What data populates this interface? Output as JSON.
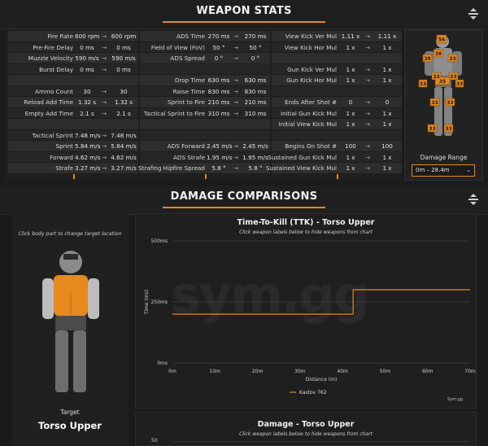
{
  "weapon_stats": {
    "title": "WEAPON STATS",
    "col1": [
      {
        "label": "Fire Rate",
        "v1": "600 rpm",
        "v2": "600 rpm"
      },
      {
        "label": "Pre-Fire Delay",
        "v1": "0 ms",
        "v2": "0 ms"
      },
      {
        "label": "Muzzle Velocity",
        "v1": "590 m/s",
        "v2": "590 m/s"
      },
      {
        "label": "Burst Delay",
        "v1": "0 ms",
        "v2": "0 ms"
      },
      {
        "label": "",
        "v1": "",
        "v2": ""
      },
      {
        "label": "Ammo Count",
        "v1": "30",
        "v2": "30"
      },
      {
        "label": "Reload Add Time",
        "v1": "1.32 s",
        "v2": "1.32 s"
      },
      {
        "label": "Empty Add Time",
        "v1": "2.1 s",
        "v2": "2.1 s"
      },
      {
        "label": "",
        "v1": "",
        "v2": ""
      },
      {
        "label": "Tactical Sprint",
        "v1": "7.48 m/s",
        "v2": "7.48 m/s"
      },
      {
        "label": "Sprint",
        "v1": "5.84 m/s",
        "v2": "5.84 m/s"
      },
      {
        "label": "Forward",
        "v1": "4.62 m/s",
        "v2": "4.62 m/s"
      },
      {
        "label": "Strafe",
        "v1": "3.27 m/s",
        "v2": "3.27 m/s"
      }
    ],
    "col2": [
      {
        "label": "ADS Time",
        "v1": "270 ms",
        "v2": "270 ms"
      },
      {
        "label": "Field of View (FoV)",
        "v1": "50 °",
        "v2": "50 °"
      },
      {
        "label": "ADS Spread",
        "v1": "0 °",
        "v2": "0 °"
      },
      {
        "label": "",
        "v1": "",
        "v2": ""
      },
      {
        "label": "Drop Time",
        "v1": "630 ms",
        "v2": "630 ms"
      },
      {
        "label": "Raise Time",
        "v1": "830 ms",
        "v2": "830 ms"
      },
      {
        "label": "Sprint to Fire",
        "v1": "210 ms",
        "v2": "210 ms"
      },
      {
        "label": "Tactical Sprint to Fire",
        "v1": "310 ms",
        "v2": "310 ms"
      },
      {
        "label": "",
        "v1": "",
        "v2": ""
      },
      {
        "label": "",
        "v1": "",
        "v2": ""
      },
      {
        "label": "ADS Forward",
        "v1": "2.45 m/s",
        "v2": "2.45 m/s"
      },
      {
        "label": "ADS Strafe",
        "v1": "1.95 m/s",
        "v2": "1.95 m/s"
      },
      {
        "label": "Strafing Hipfire Spread",
        "v1": "5.8 °",
        "v2": "5.8 °"
      }
    ],
    "col3": [
      {
        "label": "View Kick Ver Mul",
        "v1": "1.11 x",
        "v2": "1.11 x"
      },
      {
        "label": "View Kick Hor Mul",
        "v1": "1 x",
        "v2": "1 x"
      },
      {
        "label": "",
        "v1": "",
        "v2": ""
      },
      {
        "label": "Gun Kick Ver Mul",
        "v1": "1 x",
        "v2": "1 x"
      },
      {
        "label": "Gun Kick Hor Mul",
        "v1": "1 x",
        "v2": "1 x"
      },
      {
        "label": "",
        "v1": "",
        "v2": ""
      },
      {
        "label": "Ends After Shot #",
        "v1": "0",
        "v2": "0"
      },
      {
        "label": "Initial Gun Kick Mul",
        "v1": "1 x",
        "v2": "1 x"
      },
      {
        "label": "Initial View Kick Mul",
        "v1": "1 x",
        "v2": "1 x"
      },
      {
        "label": "",
        "v1": "",
        "v2": ""
      },
      {
        "label": "Begins On Shot #",
        "v1": "100",
        "v2": "100"
      },
      {
        "label": "Sustained Gun Kick Mul",
        "v1": "1 x",
        "v2": "1 x"
      },
      {
        "label": "Sustained View Kick Mul",
        "v1": "1 x",
        "v2": "1 x"
      }
    ],
    "arrow": "→",
    "hit_multipliers": {
      "head": "56",
      "neck": "38",
      "chest_left": "38",
      "chest_right": "33",
      "upper_arm_left": "33",
      "upper_arm_right": "33",
      "torso": "35",
      "hand_left": "33",
      "hand_right": "33",
      "thigh_left": "33",
      "thigh_right": "33",
      "leg_left": "33",
      "leg_right": "33"
    },
    "damage_range_label": "Damage Range",
    "damage_range_value": "0m – 28.4m"
  },
  "damage_comparisons": {
    "title": "DAMAGE COMPARISONS",
    "hint": "Click body part to change target location",
    "target_label": "Target",
    "target_name": "Torso Upper"
  },
  "chart_data": [
    {
      "type": "line",
      "title": "Time-To-Kill (TTK) - Torso Upper",
      "subtitle": "Click weapon labels below to hide weapons from chart",
      "xlabel": "Distance (m)",
      "ylabel": "Time (ms)",
      "x_ticks": [
        "0m",
        "10m",
        "20m",
        "30m",
        "40m",
        "50m",
        "60m",
        "70m"
      ],
      "y_ticks": [
        "0ms",
        "250ms",
        "500ms"
      ],
      "xlim": [
        0,
        70
      ],
      "ylim": [
        0,
        500
      ],
      "series": [
        {
          "name": "Kastov 762",
          "color": "#e68a1f",
          "x": [
            0,
            28.4,
            29,
            42.5,
            42.5,
            70
          ],
          "y": [
            200,
            200,
            200,
            200,
            300,
            300
          ]
        }
      ],
      "credit": "Sym.gg",
      "watermark": "sym.gg"
    },
    {
      "type": "line",
      "title": "Damage - Torso Upper",
      "subtitle": "Click weapon labels below to hide weapons from chart",
      "y_ticks": [
        "50"
      ]
    }
  ]
}
